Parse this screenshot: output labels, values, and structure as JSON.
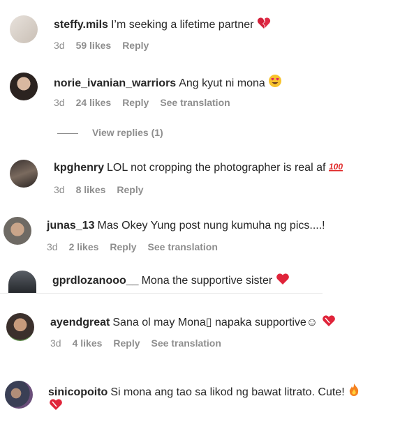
{
  "comments": [
    {
      "user": "steffy.mils",
      "text": "I’m seeking a lifetime partner",
      "emoji": "broken-heart",
      "time": "3d",
      "likes": "59 likes",
      "reply": "Reply"
    },
    {
      "user": "norie_ivanian_warriors",
      "text": "Ang kyut ni mona",
      "emoji": "heart-eyes",
      "time": "3d",
      "likes": "24 likes",
      "reply": "Reply",
      "translate": "See translation"
    },
    {
      "user": "kpghenry",
      "text": "LOL not cropping the photographer is real af",
      "emoji": "hundred",
      "time": "3d",
      "likes": "8 likes",
      "reply": "Reply"
    },
    {
      "user": "junas_13",
      "text": "Mas Okey Yung post nung kumuha ng pics....!",
      "time": "3d",
      "likes": "2 likes",
      "reply": "Reply",
      "translate": "See translation"
    },
    {
      "user": "gprdlozanooo__",
      "text": "Mona the supportive sister",
      "emoji": "red-heart"
    },
    {
      "user": "ayendgreat",
      "text": "Sana ol may Mona▯ napaka supportive☺",
      "emoji": "heart-exclamation",
      "time": "3d",
      "likes": "4 likes",
      "reply": "Reply",
      "translate": "See translation"
    },
    {
      "user": "sinicopoito",
      "text": "Si mona ang tao sa likod ng bawat litrato. Cute!",
      "emoji": "fire",
      "emoji2": "heart-exclamation"
    }
  ],
  "view_replies": "View replies (1)",
  "colors": {
    "text": "#262626",
    "meta": "#8e8e8e",
    "heart": "#ed4956"
  }
}
